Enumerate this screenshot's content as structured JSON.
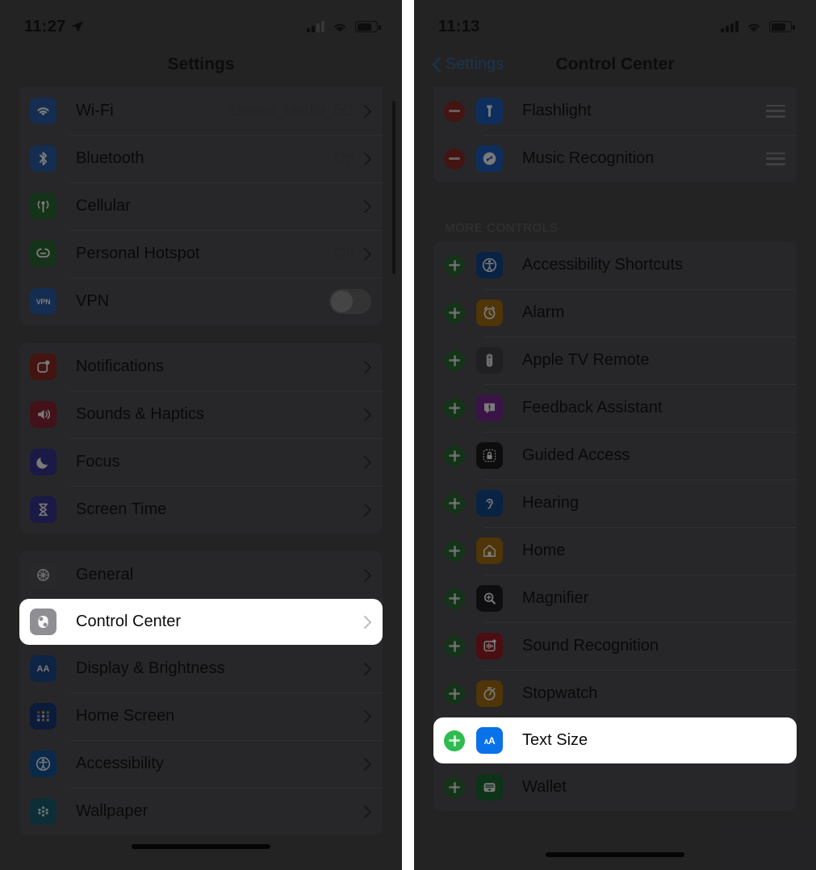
{
  "left_phone": {
    "status_bar": {
      "time": "11:27",
      "location_icon": "location-arrow-icon",
      "signal_icon": "cellular-signal-icon",
      "wifi_icon": "wifi-icon",
      "battery_icon": "battery-icon"
    },
    "nav": {
      "title": "Settings"
    },
    "groups": [
      {
        "id": "connectivity",
        "rows": [
          {
            "label": "Wi-Fi",
            "value": "iGeeks_Media_5G",
            "accessory": "chevron",
            "icon": "wifi-app-icon",
            "icon_color": "#2a5fa8"
          },
          {
            "label": "Bluetooth",
            "value": "On",
            "accessory": "chevron",
            "icon": "bluetooth-app-icon",
            "icon_color": "#2a5fa8"
          },
          {
            "label": "Cellular",
            "value": "",
            "accessory": "chevron",
            "icon": "cellular-app-icon",
            "icon_color": "#2d6b36"
          },
          {
            "label": "Personal Hotspot",
            "value": "Off",
            "accessory": "chevron",
            "icon": "hotspot-app-icon",
            "icon_color": "#2d6b36"
          },
          {
            "label": "VPN",
            "value": "",
            "accessory": "switch",
            "switch_on": false,
            "icon": "vpn-app-icon",
            "icon_color": "#2a5fa8"
          }
        ]
      },
      {
        "id": "alerts",
        "rows": [
          {
            "label": "Notifications",
            "value": "",
            "accessory": "chevron",
            "icon": "notifications-app-icon",
            "icon_color": "#8f2b22"
          },
          {
            "label": "Sounds & Haptics",
            "value": "",
            "accessory": "chevron",
            "icon": "sounds-app-icon",
            "icon_color": "#8c2535"
          },
          {
            "label": "Focus",
            "value": "",
            "accessory": "chevron",
            "icon": "focus-moon-app-icon",
            "icon_color": "#3a3593"
          },
          {
            "label": "Screen Time",
            "value": "",
            "accessory": "chevron",
            "icon": "screen-time-app-icon",
            "icon_color": "#3a3593"
          }
        ]
      },
      {
        "id": "system",
        "rows": [
          {
            "label": "General",
            "value": "",
            "accessory": "chevron",
            "icon": "general-gear-app-icon",
            "icon_color": "#55555a",
            "highlighted": false
          },
          {
            "label": "Control Center",
            "value": "",
            "accessory": "chevron",
            "icon": "control-center-app-icon",
            "icon_color": "#8e8e93",
            "highlighted": true
          },
          {
            "label": "Display & Brightness",
            "value": "",
            "accessory": "chevron",
            "icon": "display-brightness-app-icon",
            "icon_color": "#1f4d8f",
            "highlighted": false
          },
          {
            "label": "Home Screen",
            "value": "",
            "accessory": "chevron",
            "icon": "home-screen-app-icon",
            "icon_color": "#1d3a7a",
            "highlighted": false
          },
          {
            "label": "Accessibility",
            "value": "",
            "accessory": "chevron",
            "icon": "accessibility-app-icon",
            "icon_color": "#13599c",
            "highlighted": false
          },
          {
            "label": "Wallpaper",
            "value": "",
            "accessory": "chevron",
            "icon": "wallpaper-app-icon",
            "icon_color": "#1d6173",
            "highlighted": false
          }
        ]
      }
    ]
  },
  "right_phone": {
    "status_bar": {
      "time": "11:13",
      "signal_icon": "cellular-signal-icon",
      "wifi_icon": "wifi-icon",
      "battery_icon": "battery-icon"
    },
    "nav": {
      "back_label": "Settings",
      "title": "Control Center",
      "back_icon": "chevron-left-icon",
      "accent_color": "#3b6ea8"
    },
    "included_rows": [
      {
        "label": "Flashlight",
        "action": "remove",
        "icon": "flashlight-app-icon",
        "icon_color": "#1f63c4",
        "handle": "drag-handle-icon"
      },
      {
        "label": "Music Recognition",
        "action": "remove",
        "icon": "shazam-app-icon",
        "icon_color": "#1f63c4",
        "handle": "drag-handle-icon"
      }
    ],
    "more_controls_header": "MORE CONTROLS",
    "more_controls_rows": [
      {
        "label": "Accessibility Shortcuts",
        "action": "add",
        "icon": "accessibility-app-icon",
        "icon_color": "#14498f",
        "highlighted": false
      },
      {
        "label": "Alarm",
        "action": "add",
        "icon": "alarm-clock-app-icon",
        "icon_color": "#a5700f",
        "highlighted": false
      },
      {
        "label": "Apple TV Remote",
        "action": "add",
        "icon": "apple-tv-remote-app-icon",
        "icon_color": "#434347",
        "highlighted": false
      },
      {
        "label": "Feedback Assistant",
        "action": "add",
        "icon": "feedback-assistant-app-icon",
        "icon_color": "#7a2a94",
        "highlighted": false
      },
      {
        "label": "Guided Access",
        "action": "add",
        "icon": "guided-access-app-icon",
        "icon_color": "#1c1c1e",
        "highlighted": false
      },
      {
        "label": "Hearing",
        "action": "add",
        "icon": "hearing-ear-app-icon",
        "icon_color": "#14498f",
        "highlighted": false
      },
      {
        "label": "Home",
        "action": "add",
        "icon": "home-app-icon",
        "icon_color": "#a5700f",
        "highlighted": false
      },
      {
        "label": "Magnifier",
        "action": "add",
        "icon": "magnifier-app-icon",
        "icon_color": "#1f1f22",
        "highlighted": false
      },
      {
        "label": "Sound Recognition",
        "action": "add",
        "icon": "sound-recognition-app-icon",
        "icon_color": "#9b1f28",
        "highlighted": false
      },
      {
        "label": "Stopwatch",
        "action": "add",
        "icon": "stopwatch-app-icon",
        "icon_color": "#a5700f",
        "highlighted": false
      },
      {
        "label": "Text Size",
        "action": "add",
        "icon": "text-size-app-icon",
        "icon_color": "#0a72e8",
        "highlighted": true
      },
      {
        "label": "Wallet",
        "action": "add",
        "icon": "wallet-app-icon",
        "icon_color": "#1d6b33",
        "highlighted": false
      }
    ]
  },
  "highlight_color": "#ffffff",
  "add_color": "#2fbb4f",
  "remove_color": "#e03a35"
}
